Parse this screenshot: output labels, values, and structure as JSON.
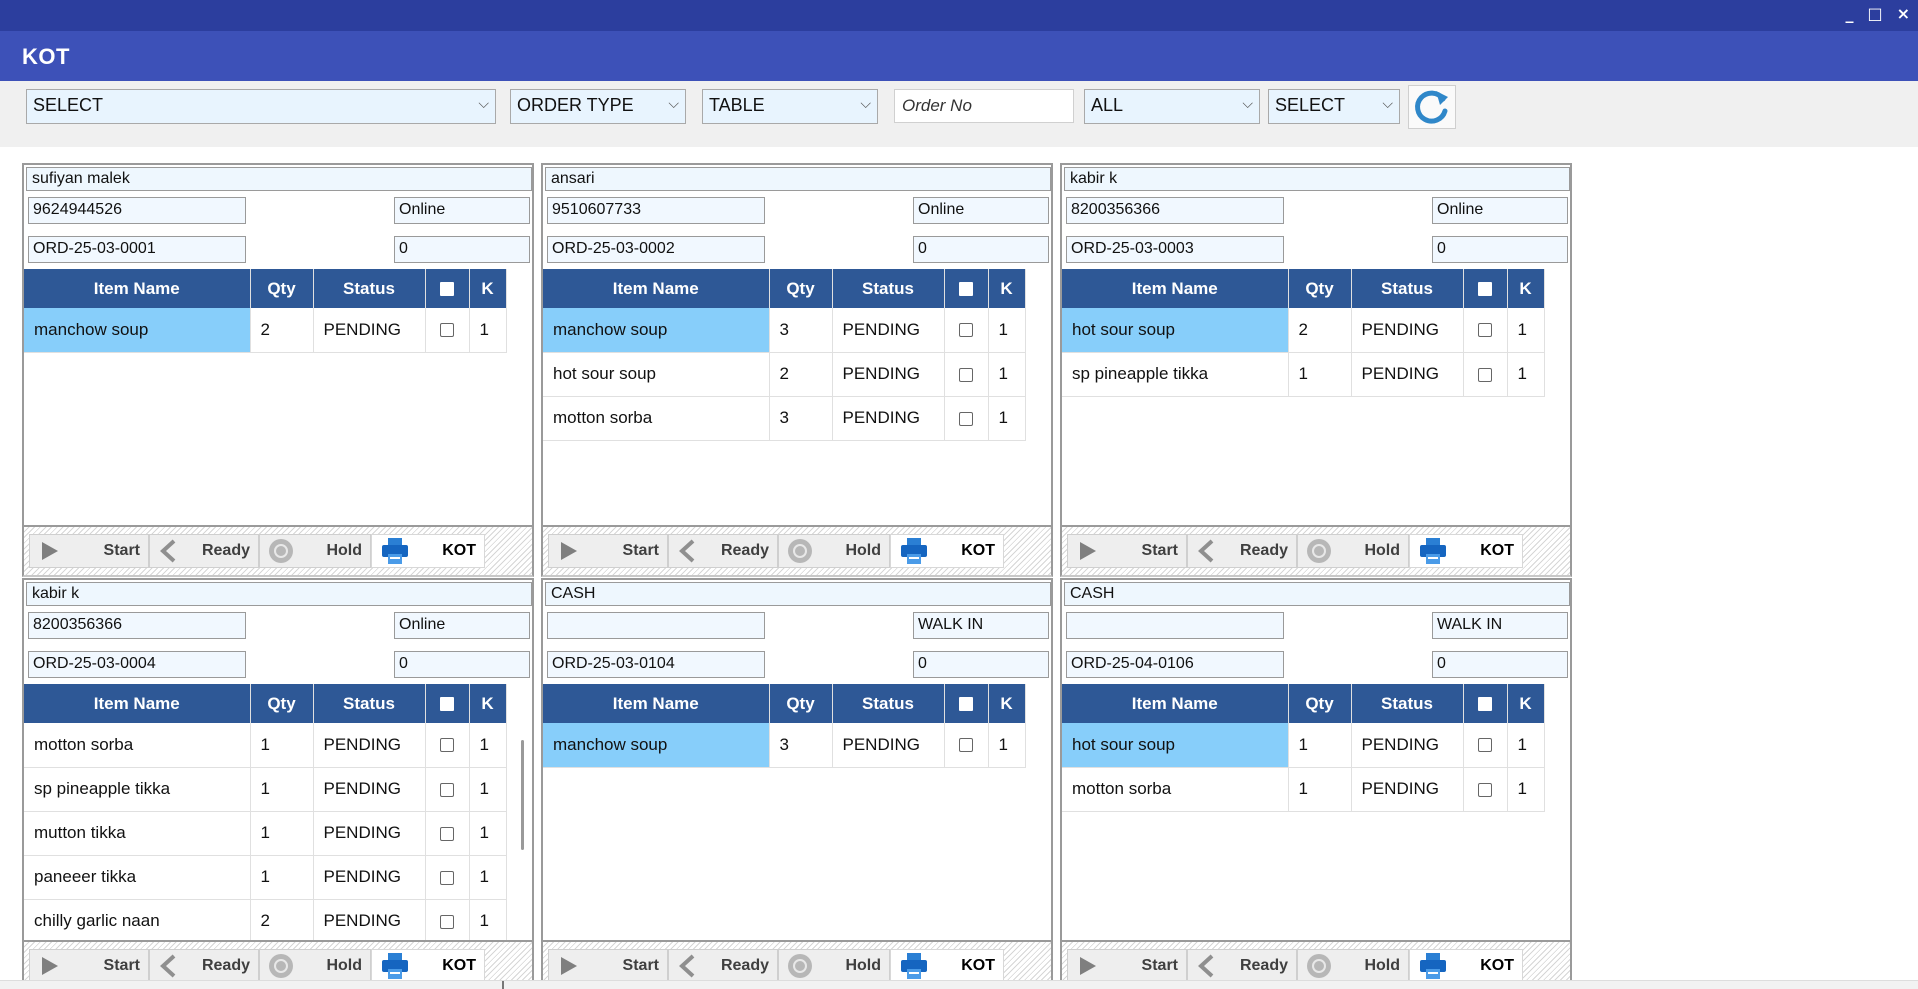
{
  "window": {
    "title": "KOT",
    "controls": [
      "_",
      "□",
      "×"
    ]
  },
  "toolbar": {
    "select1": "SELECT",
    "order_type": "ORDER TYPE",
    "table": "TABLE",
    "order_no_placeholder": "Order No",
    "status_filter": "ALL",
    "select2": "SELECT",
    "icons": {
      "dropdown": "chevron-down-icon",
      "refresh": "refresh-icon"
    }
  },
  "columns": [
    "Item Name",
    "Qty",
    "Status",
    "",
    "K"
  ],
  "action_labels": {
    "start": "Start",
    "ready": "Ready",
    "hold": "Hold",
    "kot": "KOT"
  },
  "cards": [
    {
      "name": "sufiyan malek",
      "phone": "9624944526",
      "type": "Online",
      "order": "ORD-25-03-0001",
      "num": "0",
      "items": [
        {
          "name": "manchow soup",
          "qty": "2",
          "status": "PENDING",
          "k": "1",
          "selected": true
        }
      ]
    },
    {
      "name": "ansari",
      "phone": "9510607733",
      "type": "Online",
      "order": "ORD-25-03-0002",
      "num": "0",
      "items": [
        {
          "name": "manchow soup",
          "qty": "3",
          "status": "PENDING",
          "k": "1",
          "selected": true
        },
        {
          "name": "hot sour soup",
          "qty": "2",
          "status": "PENDING",
          "k": "1"
        },
        {
          "name": "motton sorba",
          "qty": "3",
          "status": "PENDING",
          "k": "1"
        }
      ]
    },
    {
      "name": "kabir k",
      "phone": "8200356366",
      "type": "Online",
      "order": "ORD-25-03-0003",
      "num": "0",
      "items": [
        {
          "name": "hot sour soup",
          "qty": "2",
          "status": "PENDING",
          "k": "1",
          "selected": true
        },
        {
          "name": "sp pineapple tikka",
          "qty": "1",
          "status": "PENDING",
          "k": "1"
        }
      ]
    },
    {
      "name": "kabir k",
      "phone": "8200356366",
      "type": "Online",
      "order": "ORD-25-03-0004",
      "num": "0",
      "items": [
        {
          "name": "motton sorba",
          "qty": "1",
          "status": "PENDING",
          "k": "1"
        },
        {
          "name": "sp pineapple tikka",
          "qty": "1",
          "status": "PENDING",
          "k": "1"
        },
        {
          "name": "mutton tikka",
          "qty": "1",
          "status": "PENDING",
          "k": "1"
        },
        {
          "name": "paneeer tikka",
          "qty": "1",
          "status": "PENDING",
          "k": "1"
        },
        {
          "name": "chilly garlic naan",
          "qty": "2",
          "status": "PENDING",
          "k": "1"
        }
      ]
    },
    {
      "name": "CASH",
      "phone": "",
      "type": "WALK IN",
      "order": "ORD-25-03-0104",
      "num": "0",
      "items": [
        {
          "name": "manchow soup",
          "qty": "3",
          "status": "PENDING",
          "k": "1",
          "selected": true
        }
      ]
    },
    {
      "name": "CASH",
      "phone": "",
      "type": "WALK IN",
      "order": "ORD-25-04-0106",
      "num": "0",
      "items": [
        {
          "name": "hot sour soup",
          "qty": "1",
          "status": "PENDING",
          "k": "1",
          "selected": true
        },
        {
          "name": "motton sorba",
          "qty": "1",
          "status": "PENDING",
          "k": "1"
        }
      ]
    }
  ]
}
